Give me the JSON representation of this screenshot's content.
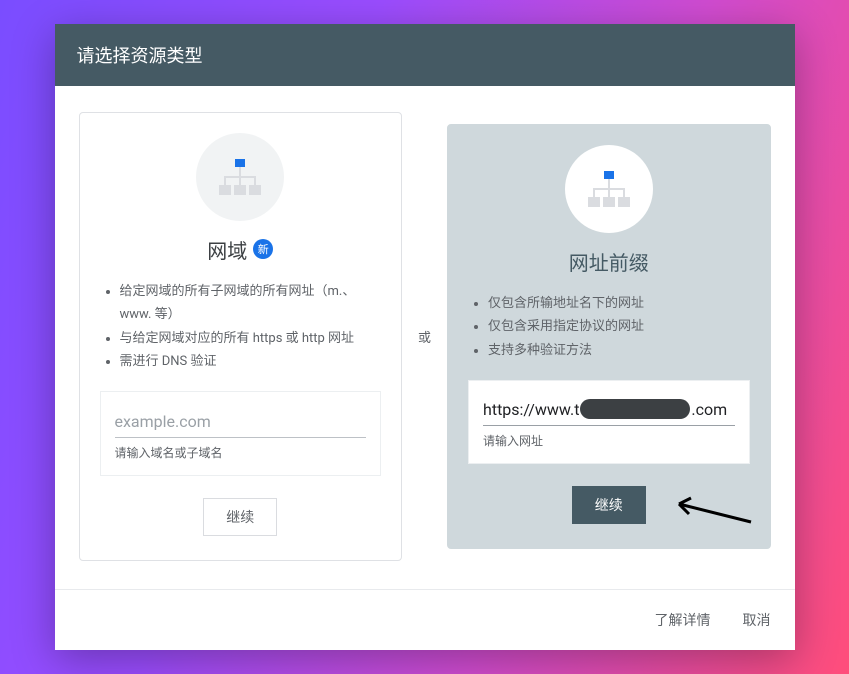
{
  "header": {
    "title": "请选择资源类型"
  },
  "separator": "或",
  "domain_card": {
    "title": "网域",
    "badge": "新",
    "features": [
      "给定网域的所有子网域的所有网址（m.、www. 等）",
      "与给定网域对应的所有 https 或 http 网址",
      "需进行 DNS 验证"
    ],
    "input_placeholder": "example.com",
    "input_value": "",
    "input_hint": "请输入域名或子域名",
    "continue_label": "继续"
  },
  "prefix_card": {
    "title": "网址前缀",
    "features": [
      "仅包含所输地址名下的网址",
      "仅包含采用指定协议的网址",
      "支持多种验证方法"
    ],
    "url_prefix": "https://www.t",
    "url_suffix": ".com",
    "input_hint": "请输入网址",
    "continue_label": "继续"
  },
  "footer": {
    "learn_more": "了解详情",
    "cancel": "取消"
  }
}
